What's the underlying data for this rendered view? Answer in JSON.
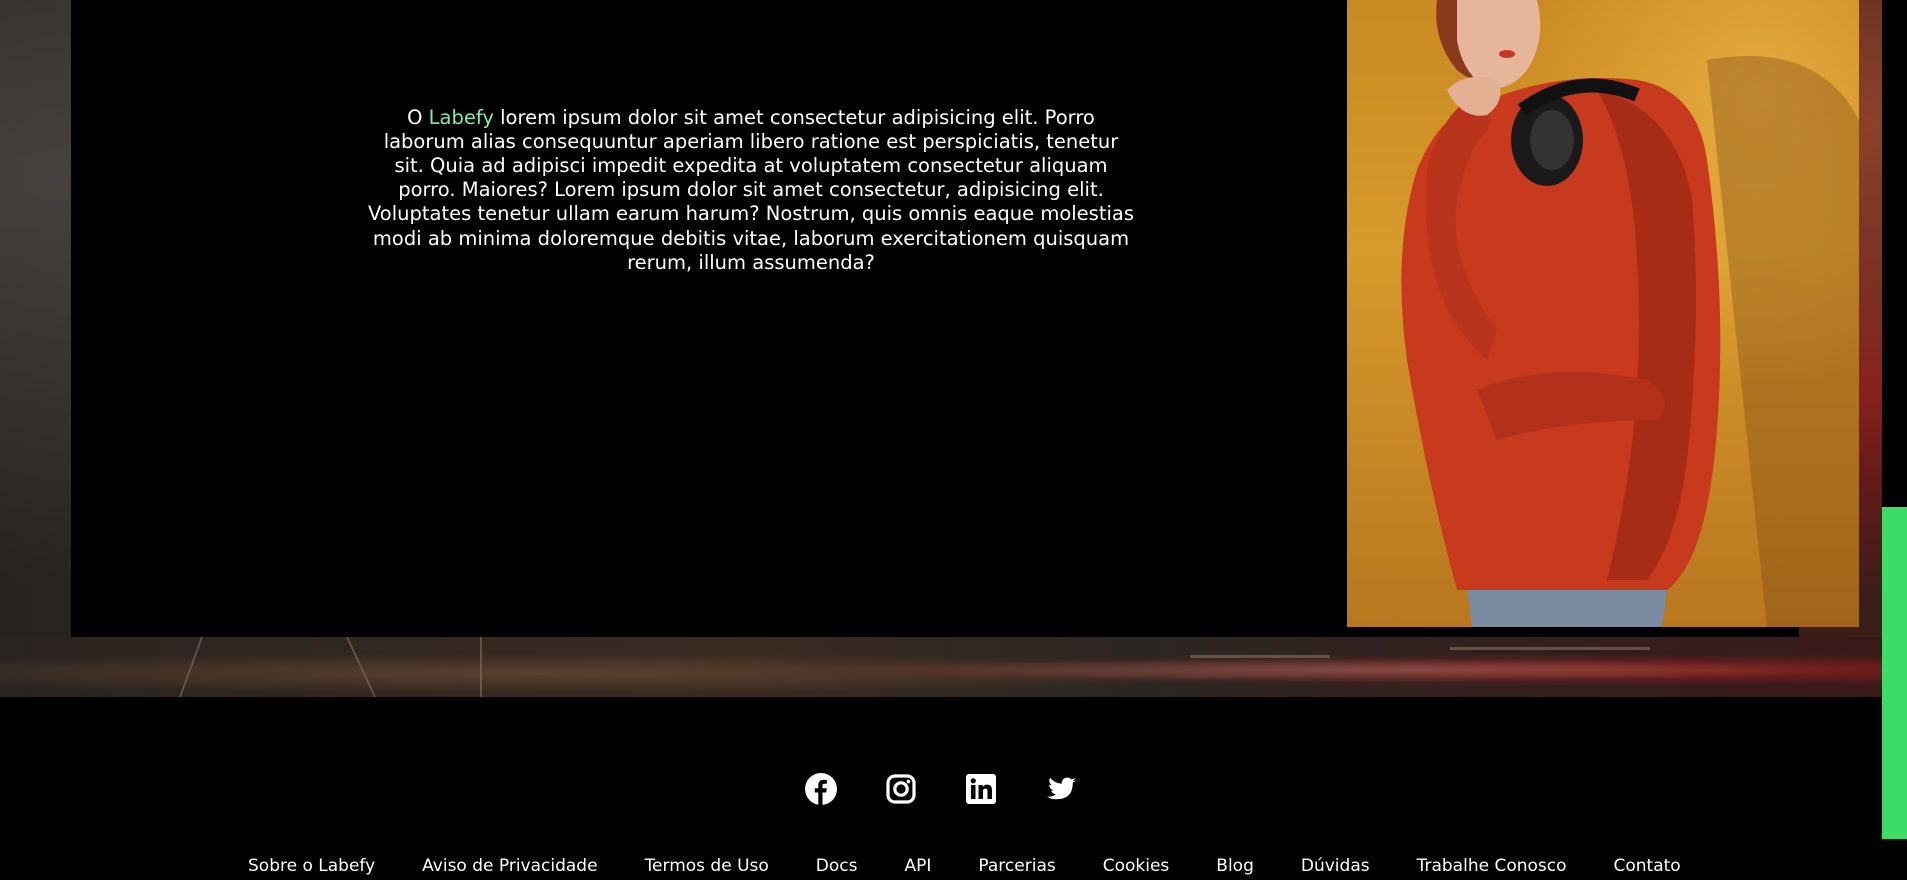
{
  "about": {
    "prefix": "O",
    "brand": "Labefy",
    "body": "lorem ipsum dolor sit amet consectetur adipisicing elit. Porro laborum alias consequuntur aperiam libero ratione est perspiciatis, tenetur sit. Quia ad adipisci impedit expedita at voluptatem consectetur aliquam porro. Maiores? Lorem ipsum dolor sit amet consectetur, adipisicing elit. Voluptates tenetur ullam earum harum? Nostrum, quis omnis eaque molestias modi ab minima doloremque debitis vitae, laborum exercitationem quisquam rerum, illum assumenda?",
    "brand_color": "#7ff0a0"
  },
  "hero_image": {
    "icon": "woman-with-headphones-photo"
  },
  "footer": {
    "socials": [
      {
        "icon": "facebook-icon"
      },
      {
        "icon": "instagram-icon"
      },
      {
        "icon": "linkedin-icon"
      },
      {
        "icon": "twitter-icon"
      }
    ],
    "links": [
      "Sobre o Labefy",
      "Aviso de Privacidade",
      "Termos de Uso",
      "Docs",
      "API",
      "Parcerias",
      "Cookies",
      "Blog",
      "Dúvidas",
      "Trabalhe Conosco",
      "Contato"
    ]
  },
  "colors": {
    "accent": "#3ddc68",
    "panel": "#000000"
  }
}
